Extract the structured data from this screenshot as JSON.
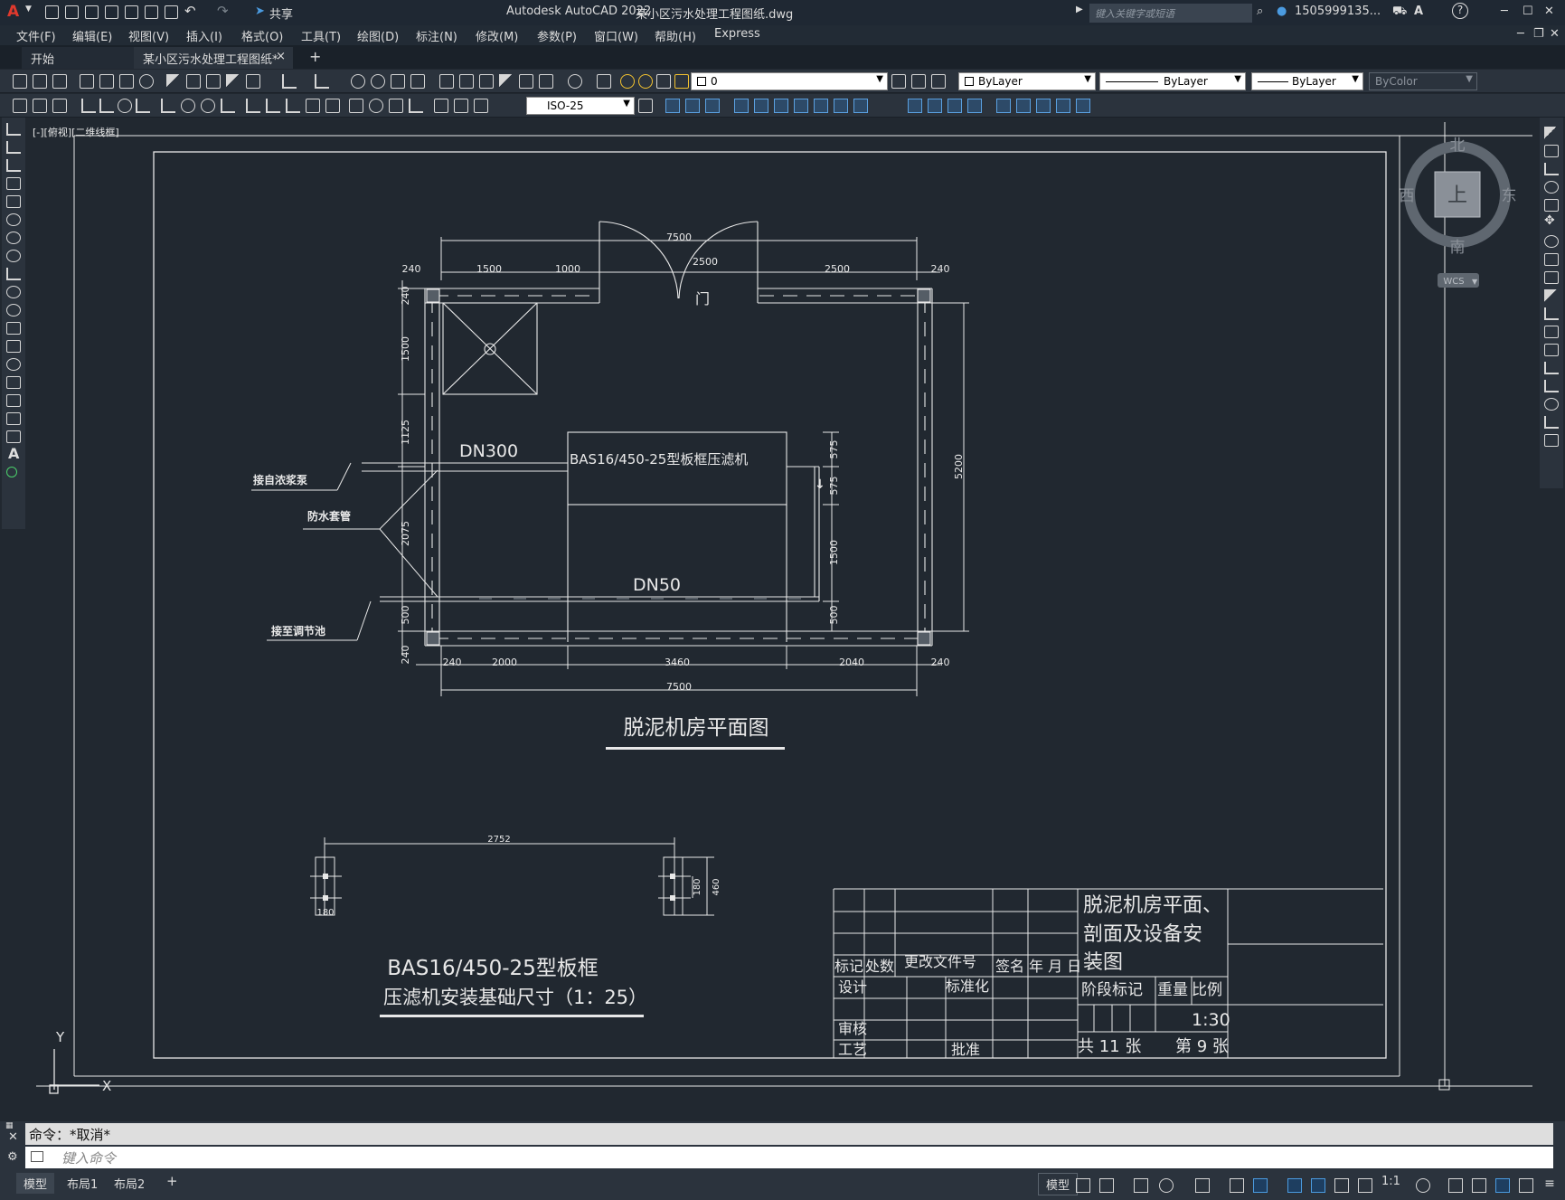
{
  "title_bar": {
    "app_logo": "A",
    "share_label": "共享",
    "title": "Autodesk AutoCAD 2022",
    "filename": "某小区污水处理工程图纸.dwg",
    "search_placeholder": "键入关键字或短语",
    "user": "1505999135...",
    "help_icon": "?"
  },
  "menu": [
    "文件(F)",
    "编辑(E)",
    "视图(V)",
    "插入(I)",
    "格式(O)",
    "工具(T)",
    "绘图(D)",
    "标注(N)",
    "修改(M)",
    "参数(P)",
    "窗口(W)",
    "帮助(H)",
    "Express"
  ],
  "tabs": {
    "start": "开始",
    "drawing": "某小区污水处理工程图纸*",
    "close": "×",
    "add": "+"
  },
  "layer_toolbar": {
    "layer": "0",
    "color": "ByLayer",
    "linetype": "ByLayer",
    "lineweight": "ByLayer",
    "plotstyle": "ByColor"
  },
  "dim_style": "ISO-25",
  "viewport_label": "[-][俯视][二维线框]",
  "viewcube": {
    "north": "北",
    "south": "南",
    "east": "东",
    "west": "西",
    "top": "上",
    "wcs": "WCS"
  },
  "ucs": {
    "x": "X",
    "y": "Y"
  },
  "drawing": {
    "plan_title": "脱泥机房平面图",
    "door_label": "门",
    "machine_label": "BAS16/450-25型板框压滤机",
    "pipe_dn300": "DN300",
    "pipe_dn50": "DN50",
    "callouts": [
      "接自浓浆泵",
      "防水套管",
      "接至调节池"
    ],
    "dims_top": [
      "7500",
      "240",
      "1500",
      "1000",
      "2500",
      "2500",
      "240"
    ],
    "dims_left": [
      "240",
      "1500",
      "1125",
      "2075",
      "500",
      "240"
    ],
    "dims_right_inner": [
      "575",
      "575",
      "1500",
      "500"
    ],
    "dim_right_outer": "5200",
    "dims_bottom": [
      "240",
      "2000",
      "3460",
      "2040",
      "240"
    ],
    "dim_bottom_total": "7500",
    "found_dim_width": "2752",
    "found_dim_small": "180",
    "found_dim_180r": "180",
    "found_dim_460": "460",
    "found_title_1": "BAS16/450-25型板框",
    "found_title_2": "压滤机安装基础尺寸（1：25）"
  },
  "title_block": {
    "drawing_name_1": "脱泥机房平面、",
    "drawing_name_2": "剖面及设备安",
    "drawing_name_3": "装图",
    "row_marks": [
      "标记",
      "处数",
      "更改文件号",
      "签名",
      "年 月 日"
    ],
    "design": "设计",
    "standard": "标准化",
    "review": "审核",
    "process": "工艺",
    "approve": "批准",
    "stage": "阶段标记",
    "weight": "重量",
    "scale_label": "比例",
    "scale": "1:30",
    "sheets_total": "共 11  张",
    "sheet_no": "第 9  张"
  },
  "command": {
    "history": "命令：*取消*",
    "placeholder": "键入命令"
  },
  "status": {
    "model": "模型",
    "layout1": "布局1",
    "layout2": "布局2",
    "add": "+",
    "model_btn": "模型",
    "scale": "1:1"
  }
}
